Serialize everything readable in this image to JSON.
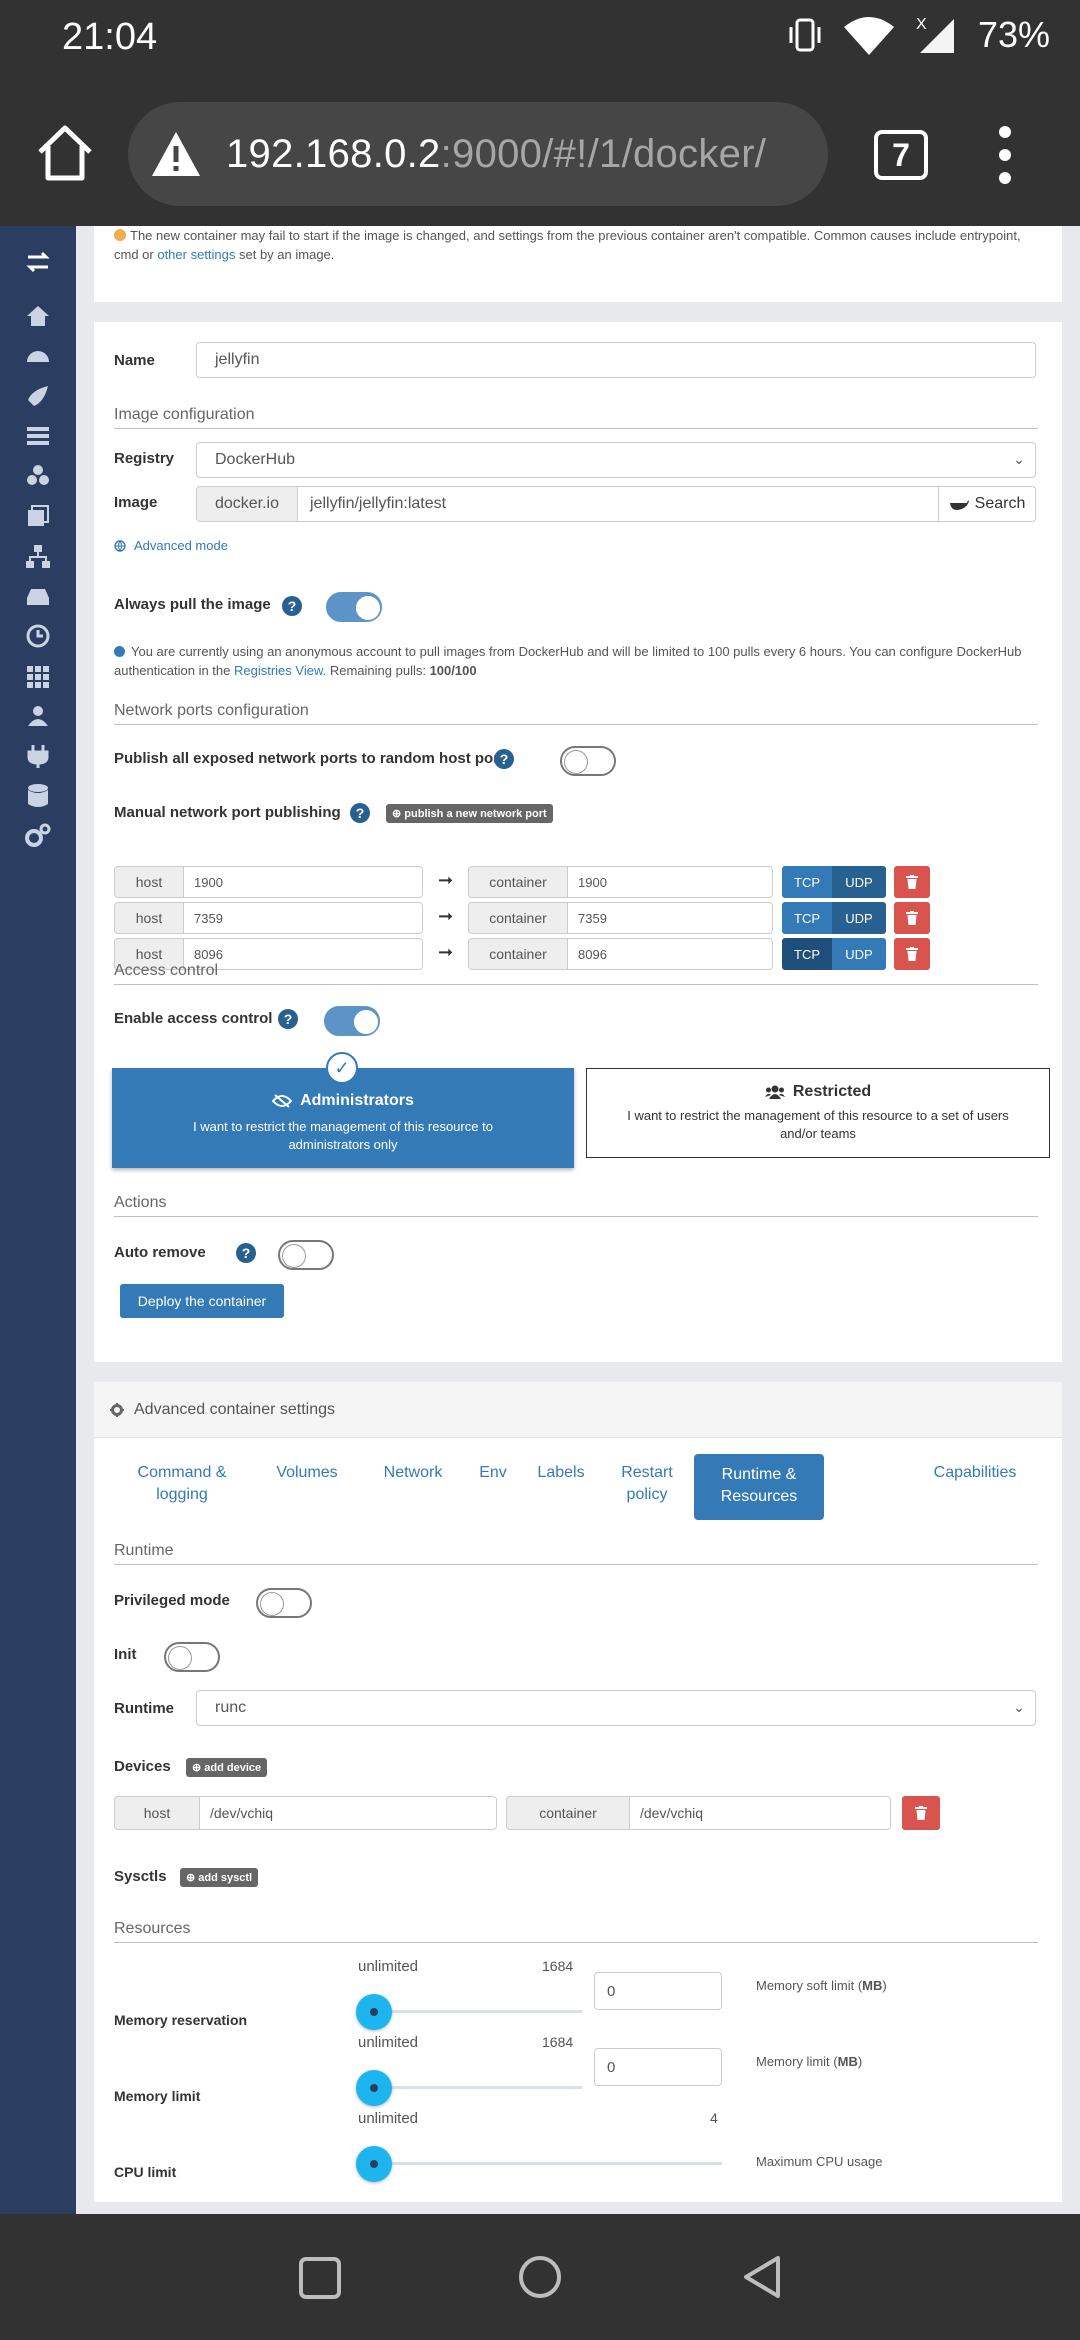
{
  "status": {
    "time": "21:04",
    "battery": "73%"
  },
  "browser": {
    "url_host": "192.168.0.2",
    "url_rest": ":9000/#!/1/docker/",
    "tab_count": "7"
  },
  "warning_note": {
    "text_before": "The new container may fail to start if the image is changed, and settings from the previous container aren't compatible. Common causes include entrypoint, cmd or ",
    "link": "other settings",
    "text_after": " set by an image."
  },
  "form": {
    "name_label": "Name",
    "name_value": "jellyfin",
    "image_config_title": "Image configuration",
    "registry_label": "Registry",
    "registry_value": "DockerHub",
    "image_label": "Image",
    "image_prefix": "docker.io",
    "image_value": "jellyfin/jellyfin:latest",
    "search_label": "Search",
    "advanced_mode": "Advanced mode",
    "always_pull_label": "Always pull the image",
    "pull_info_1": "You are currently using an anonymous account to pull images from DockerHub and will be limited to 100 pulls every 6 hours. You can configure DockerHub authentication in the ",
    "pull_info_link": "Registries View",
    "pull_info_2": ". Remaining pulls: ",
    "pull_info_count": "100/100"
  },
  "network": {
    "title": "Network ports configuration",
    "publish_all_label": "Publish all exposed network ports to random host ports",
    "manual_label": "Manual network port publishing",
    "publish_badge": "publish a new network port",
    "host_label": "host",
    "container_label": "container",
    "tcp": "TCP",
    "udp": "UDP",
    "ports": [
      {
        "host": "1900",
        "container": "1900"
      },
      {
        "host": "7359",
        "container": "7359"
      },
      {
        "host": "8096",
        "container": "8096"
      }
    ]
  },
  "access": {
    "title": "Access control",
    "enable_label": "Enable access control",
    "admin_title": "Administrators",
    "admin_desc": "I want to restrict the management of this resource to administrators only",
    "restricted_title": "Restricted",
    "restricted_desc": "I want to restrict the management of this resource to a set of users and/or teams"
  },
  "actions": {
    "title": "Actions",
    "auto_remove_label": "Auto remove",
    "deploy_label": "Deploy the container"
  },
  "advanced": {
    "title": "Advanced container settings",
    "tabs": [
      "Command &\nlogging",
      "Volumes",
      "Network",
      "Env",
      "Labels",
      "Restart\npolicy",
      "Runtime &\nResources",
      "Capabilities"
    ]
  },
  "runtime": {
    "title": "Runtime",
    "privileged_label": "Privileged mode",
    "init_label": "Init",
    "runtime_label": "Runtime",
    "runtime_value": "runc",
    "devices_label": "Devices",
    "add_device": "add device",
    "device_host_label": "host",
    "device_host_value": "/dev/vchiq",
    "device_container_label": "container",
    "device_container_value": "/dev/vchiq",
    "sysctls_label": "Sysctls",
    "add_sysctl": "add sysctl"
  },
  "resources": {
    "title": "Resources",
    "memory_reservation": {
      "label": "Memory reservation",
      "min": "unlimited",
      "max": "1684",
      "value": "0",
      "hint_1": "Memory soft limit (",
      "hint_unit": "MB",
      "hint_2": ")"
    },
    "memory_limit": {
      "label": "Memory limit",
      "min": "unlimited",
      "max": "1684",
      "value": "0",
      "hint_1": "Memory limit (",
      "hint_unit": "MB",
      "hint_2": ")"
    },
    "cpu_limit": {
      "label": "CPU limit",
      "min": "unlimited",
      "max": "4",
      "hint": "Maximum CPU usage"
    }
  },
  "colors": {
    "accent": "#337ab7",
    "sidebar": "#2b3d61",
    "danger": "#d9534f",
    "slider": "#1cb5f0"
  }
}
